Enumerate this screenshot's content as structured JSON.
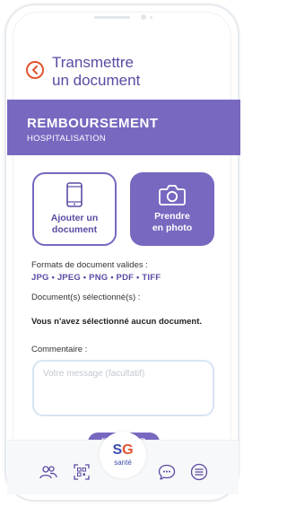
{
  "header": {
    "title_line1": "Transmettre",
    "title_line2": "un document"
  },
  "banner": {
    "title": "REMBOURSEMENT",
    "subtitle": "HOSPITALISATION"
  },
  "actions": {
    "add_line1": "Ajouter un",
    "add_line2": "document",
    "photo_line1": "Prendre",
    "photo_line2": "en photo"
  },
  "formats": {
    "label": "Formats de document valides :",
    "list": "JPG • JPEG • PNG • PDF • TIFF"
  },
  "selection": {
    "label": "Document(s) sélectionné(s) :",
    "empty_message": "Vous n'avez sélectionné aucun document."
  },
  "comment": {
    "label": "Commentaire :",
    "placeholder": "Votre message (facultatif)"
  },
  "send_button": "ENVOYER",
  "logo": {
    "s": "S",
    "g": "G",
    "sante": "santé"
  },
  "colors": {
    "primary": "#7868c0",
    "primary_dark": "#5a4ba2",
    "accent": "#e0542f"
  },
  "tabs": [
    "people-icon",
    "qr-code-icon",
    "chat-icon",
    "menu-icon"
  ]
}
